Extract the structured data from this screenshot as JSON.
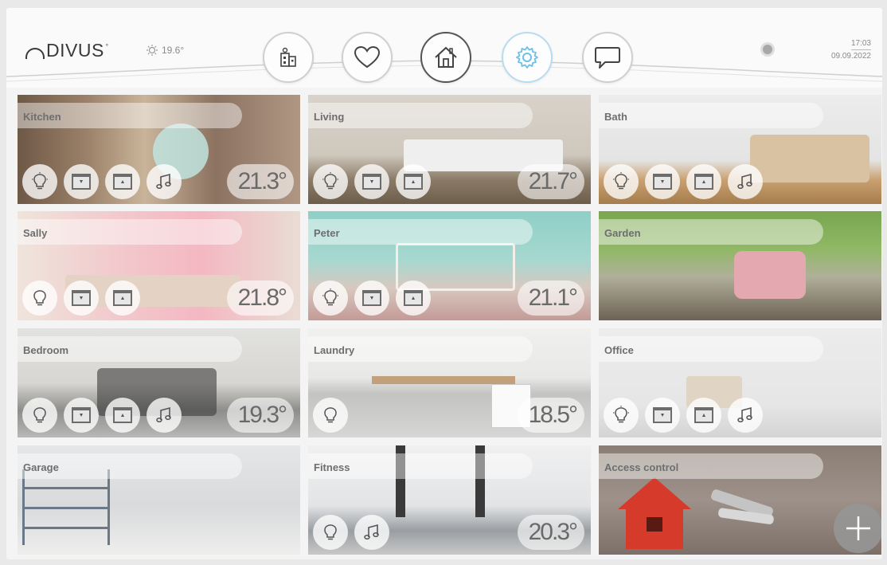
{
  "header": {
    "brand": "DIVUS",
    "brand_mark": "°",
    "outdoor_temp": "19.6°",
    "time": "17:03",
    "date": "09.09.2022",
    "nav": [
      {
        "icon": "building-icon"
      },
      {
        "icon": "heart-icon"
      },
      {
        "icon": "home-icon"
      },
      {
        "icon": "gear-icon"
      },
      {
        "icon": "chat-icon"
      }
    ]
  },
  "rooms": [
    {
      "name": "Kitchen",
      "temp": "21.3°",
      "controls": [
        "bulb-icon",
        "blind-down-icon",
        "blind-up-icon",
        "music-icon"
      ]
    },
    {
      "name": "Living",
      "temp": "21.7°",
      "controls": [
        "bulb-icon",
        "blind-down-icon",
        "blind-up-icon"
      ]
    },
    {
      "name": "Bath",
      "temp": "",
      "controls": [
        "bulb-icon",
        "blind-down-icon",
        "blind-up-icon",
        "music-icon"
      ]
    },
    {
      "name": "Sally",
      "temp": "21.8°",
      "controls": [
        "bulb-icon",
        "blind-down-icon",
        "blind-up-icon"
      ]
    },
    {
      "name": "Peter",
      "temp": "21.1°",
      "controls": [
        "bulb-icon",
        "blind-down-icon",
        "blind-up-icon"
      ]
    },
    {
      "name": "Garden",
      "temp": "",
      "controls": []
    },
    {
      "name": "Bedroom",
      "temp": "19.3°",
      "controls": [
        "bulb-icon",
        "blind-down-icon",
        "blind-up-icon",
        "music-icon"
      ]
    },
    {
      "name": "Laundry",
      "temp": "18.5°",
      "controls": [
        "bulb-icon"
      ]
    },
    {
      "name": "Office",
      "temp": "",
      "controls": [
        "bulb-icon",
        "blind-down-icon",
        "blind-up-icon",
        "music-icon"
      ]
    },
    {
      "name": "Garage",
      "temp": "",
      "controls": []
    },
    {
      "name": "Fitness",
      "temp": "20.3°",
      "controls": [
        "bulb-icon",
        "music-icon"
      ]
    },
    {
      "name": "Access control",
      "temp": "",
      "controls": []
    }
  ],
  "add_button": {
    "icon": "plus-icon"
  },
  "colors": {
    "accent": "#b8dcef",
    "text": "#6e6e6e",
    "access_house": "#d63a2a"
  }
}
